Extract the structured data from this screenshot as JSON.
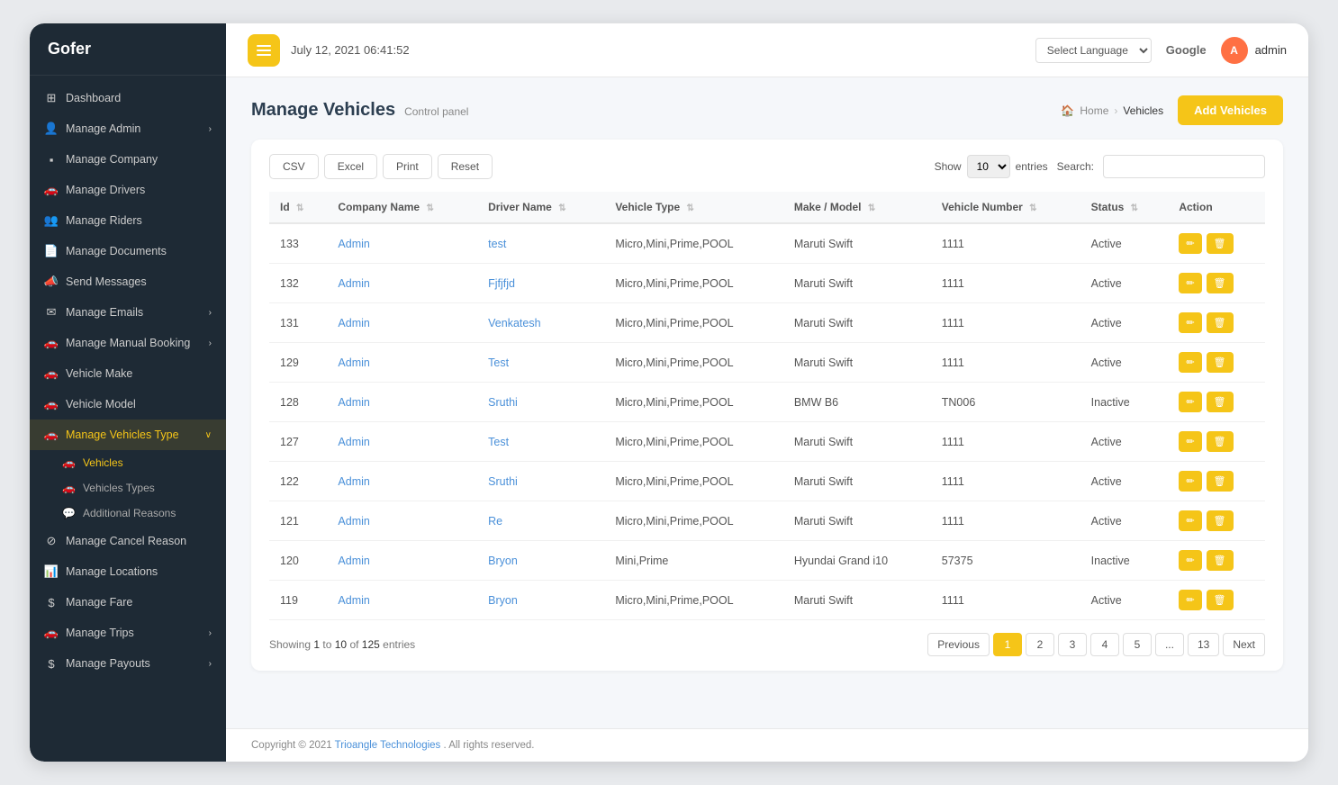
{
  "app": {
    "name": "Gofer"
  },
  "header": {
    "datetime": "July 12, 2021 06:41:52",
    "language_select": "Select Language",
    "google_label": "Google",
    "admin_name": "admin",
    "admin_initials": "A",
    "menu_icon_label": "menu-icon"
  },
  "sidebar": {
    "logo": "Gofer",
    "items": [
      {
        "id": "dashboard",
        "label": "Dashboard",
        "icon": "⊞",
        "has_arrow": false
      },
      {
        "id": "manage-admin",
        "label": "Manage Admin",
        "icon": "👤",
        "has_arrow": true
      },
      {
        "id": "manage-company",
        "label": "Manage Company",
        "icon": "▪",
        "has_arrow": false
      },
      {
        "id": "manage-drivers",
        "label": "Manage Drivers",
        "icon": "🚗",
        "has_arrow": false
      },
      {
        "id": "manage-riders",
        "label": "Manage Riders",
        "icon": "👥",
        "has_arrow": false
      },
      {
        "id": "manage-documents",
        "label": "Manage Documents",
        "icon": "📄",
        "has_arrow": false
      },
      {
        "id": "send-messages",
        "label": "Send Messages",
        "icon": "📣",
        "has_arrow": false
      },
      {
        "id": "manage-emails",
        "label": "Manage Emails",
        "icon": "✉",
        "has_arrow": true
      },
      {
        "id": "manage-manual-booking",
        "label": "Manage Manual Booking",
        "icon": "🚗",
        "has_arrow": true
      },
      {
        "id": "vehicle-make",
        "label": "Vehicle Make",
        "icon": "🚗",
        "has_arrow": false
      },
      {
        "id": "vehicle-model",
        "label": "Vehicle Model",
        "icon": "🚗",
        "has_arrow": false
      },
      {
        "id": "manage-vehicles-type",
        "label": "Manage Vehicles Type",
        "icon": "🚗",
        "has_arrow": true,
        "active": true
      },
      {
        "id": "vehicles",
        "label": "Vehicles",
        "icon": "🚗",
        "sub": true,
        "active": true
      },
      {
        "id": "vehicles-types",
        "label": "Vehicles Types",
        "icon": "🚗",
        "sub": true
      },
      {
        "id": "additional-reasons",
        "label": "Additional Reasons",
        "icon": "💬",
        "sub": true
      },
      {
        "id": "manage-cancel-reason",
        "label": "Manage Cancel Reason",
        "icon": "⊘",
        "has_arrow": false
      },
      {
        "id": "manage-locations",
        "label": "Manage Locations",
        "icon": "📊",
        "has_arrow": false
      },
      {
        "id": "manage-fare",
        "label": "Manage Fare",
        "icon": "$",
        "has_arrow": false
      },
      {
        "id": "manage-trips",
        "label": "Manage Trips",
        "icon": "🚗",
        "has_arrow": true
      },
      {
        "id": "manage-payouts",
        "label": "Manage Payouts",
        "icon": "$",
        "has_arrow": true
      }
    ]
  },
  "page": {
    "title": "Manage Vehicles",
    "subtitle": "Control panel",
    "breadcrumb_home": "Home",
    "breadcrumb_current": "Vehicles",
    "add_button": "Add Vehicles"
  },
  "table_controls": {
    "csv_label": "CSV",
    "excel_label": "Excel",
    "print_label": "Print",
    "reset_label": "Reset",
    "show_label": "Show",
    "entries_label": "entries",
    "entries_value": "10",
    "search_label": "Search:",
    "search_placeholder": ""
  },
  "table": {
    "columns": [
      {
        "id": "id",
        "label": "Id",
        "sortable": true
      },
      {
        "id": "company_name",
        "label": "Company Name",
        "sortable": true
      },
      {
        "id": "driver_name",
        "label": "Driver Name",
        "sortable": true
      },
      {
        "id": "vehicle_type",
        "label": "Vehicle Type",
        "sortable": true
      },
      {
        "id": "make_model",
        "label": "Make / Model",
        "sortable": true
      },
      {
        "id": "vehicle_number",
        "label": "Vehicle Number",
        "sortable": true
      },
      {
        "id": "status",
        "label": "Status",
        "sortable": true
      },
      {
        "id": "action",
        "label": "Action",
        "sortable": false
      }
    ],
    "rows": [
      {
        "id": "133",
        "company": "Admin",
        "driver": "test",
        "vehicle_type": "Micro,Mini,Prime,POOL",
        "make_model": "Maruti Swift",
        "vehicle_number": "1111",
        "status": "Active"
      },
      {
        "id": "132",
        "company": "Admin",
        "driver": "Fjfjfjd",
        "vehicle_type": "Micro,Mini,Prime,POOL",
        "make_model": "Maruti Swift",
        "vehicle_number": "1111",
        "status": "Active"
      },
      {
        "id": "131",
        "company": "Admin",
        "driver": "Venkatesh",
        "vehicle_type": "Micro,Mini,Prime,POOL",
        "make_model": "Maruti Swift",
        "vehicle_number": "1111",
        "status": "Active"
      },
      {
        "id": "129",
        "company": "Admin",
        "driver": "Test",
        "vehicle_type": "Micro,Mini,Prime,POOL",
        "make_model": "Maruti Swift",
        "vehicle_number": "1111",
        "status": "Active"
      },
      {
        "id": "128",
        "company": "Admin",
        "driver": "Sruthi",
        "vehicle_type": "Micro,Mini,Prime,POOL",
        "make_model": "BMW B6",
        "vehicle_number": "TN006",
        "status": "Inactive"
      },
      {
        "id": "127",
        "company": "Admin",
        "driver": "Test",
        "vehicle_type": "Micro,Mini,Prime,POOL",
        "make_model": "Maruti Swift",
        "vehicle_number": "1111",
        "status": "Active"
      },
      {
        "id": "122",
        "company": "Admin",
        "driver": "Sruthi",
        "vehicle_type": "Micro,Mini,Prime,POOL",
        "make_model": "Maruti Swift",
        "vehicle_number": "1111",
        "status": "Active"
      },
      {
        "id": "121",
        "company": "Admin",
        "driver": "Re",
        "vehicle_type": "Micro,Mini,Prime,POOL",
        "make_model": "Maruti Swift",
        "vehicle_number": "1111",
        "status": "Active"
      },
      {
        "id": "120",
        "company": "Admin",
        "driver": "Bryon",
        "vehicle_type": "Mini,Prime",
        "make_model": "Hyundai Grand i10",
        "vehicle_number": "57375",
        "status": "Inactive"
      },
      {
        "id": "119",
        "company": "Admin",
        "driver": "Bryon",
        "vehicle_type": "Micro,Mini,Prime,POOL",
        "make_model": "Maruti Swift",
        "vehicle_number": "1111",
        "status": "Active"
      }
    ]
  },
  "pagination": {
    "showing_text": "Showing 1 to 10 of 125 entries",
    "showing_from": "1",
    "showing_to": "10",
    "showing_total": "125",
    "previous_label": "Previous",
    "next_label": "Next",
    "pages": [
      "1",
      "2",
      "3",
      "4",
      "5",
      "...",
      "13"
    ],
    "current_page": "1"
  },
  "footer": {
    "copyright": "Copyright © 2021",
    "company_name": "Trioangle Technologies",
    "suffix": " . All rights reserved."
  }
}
